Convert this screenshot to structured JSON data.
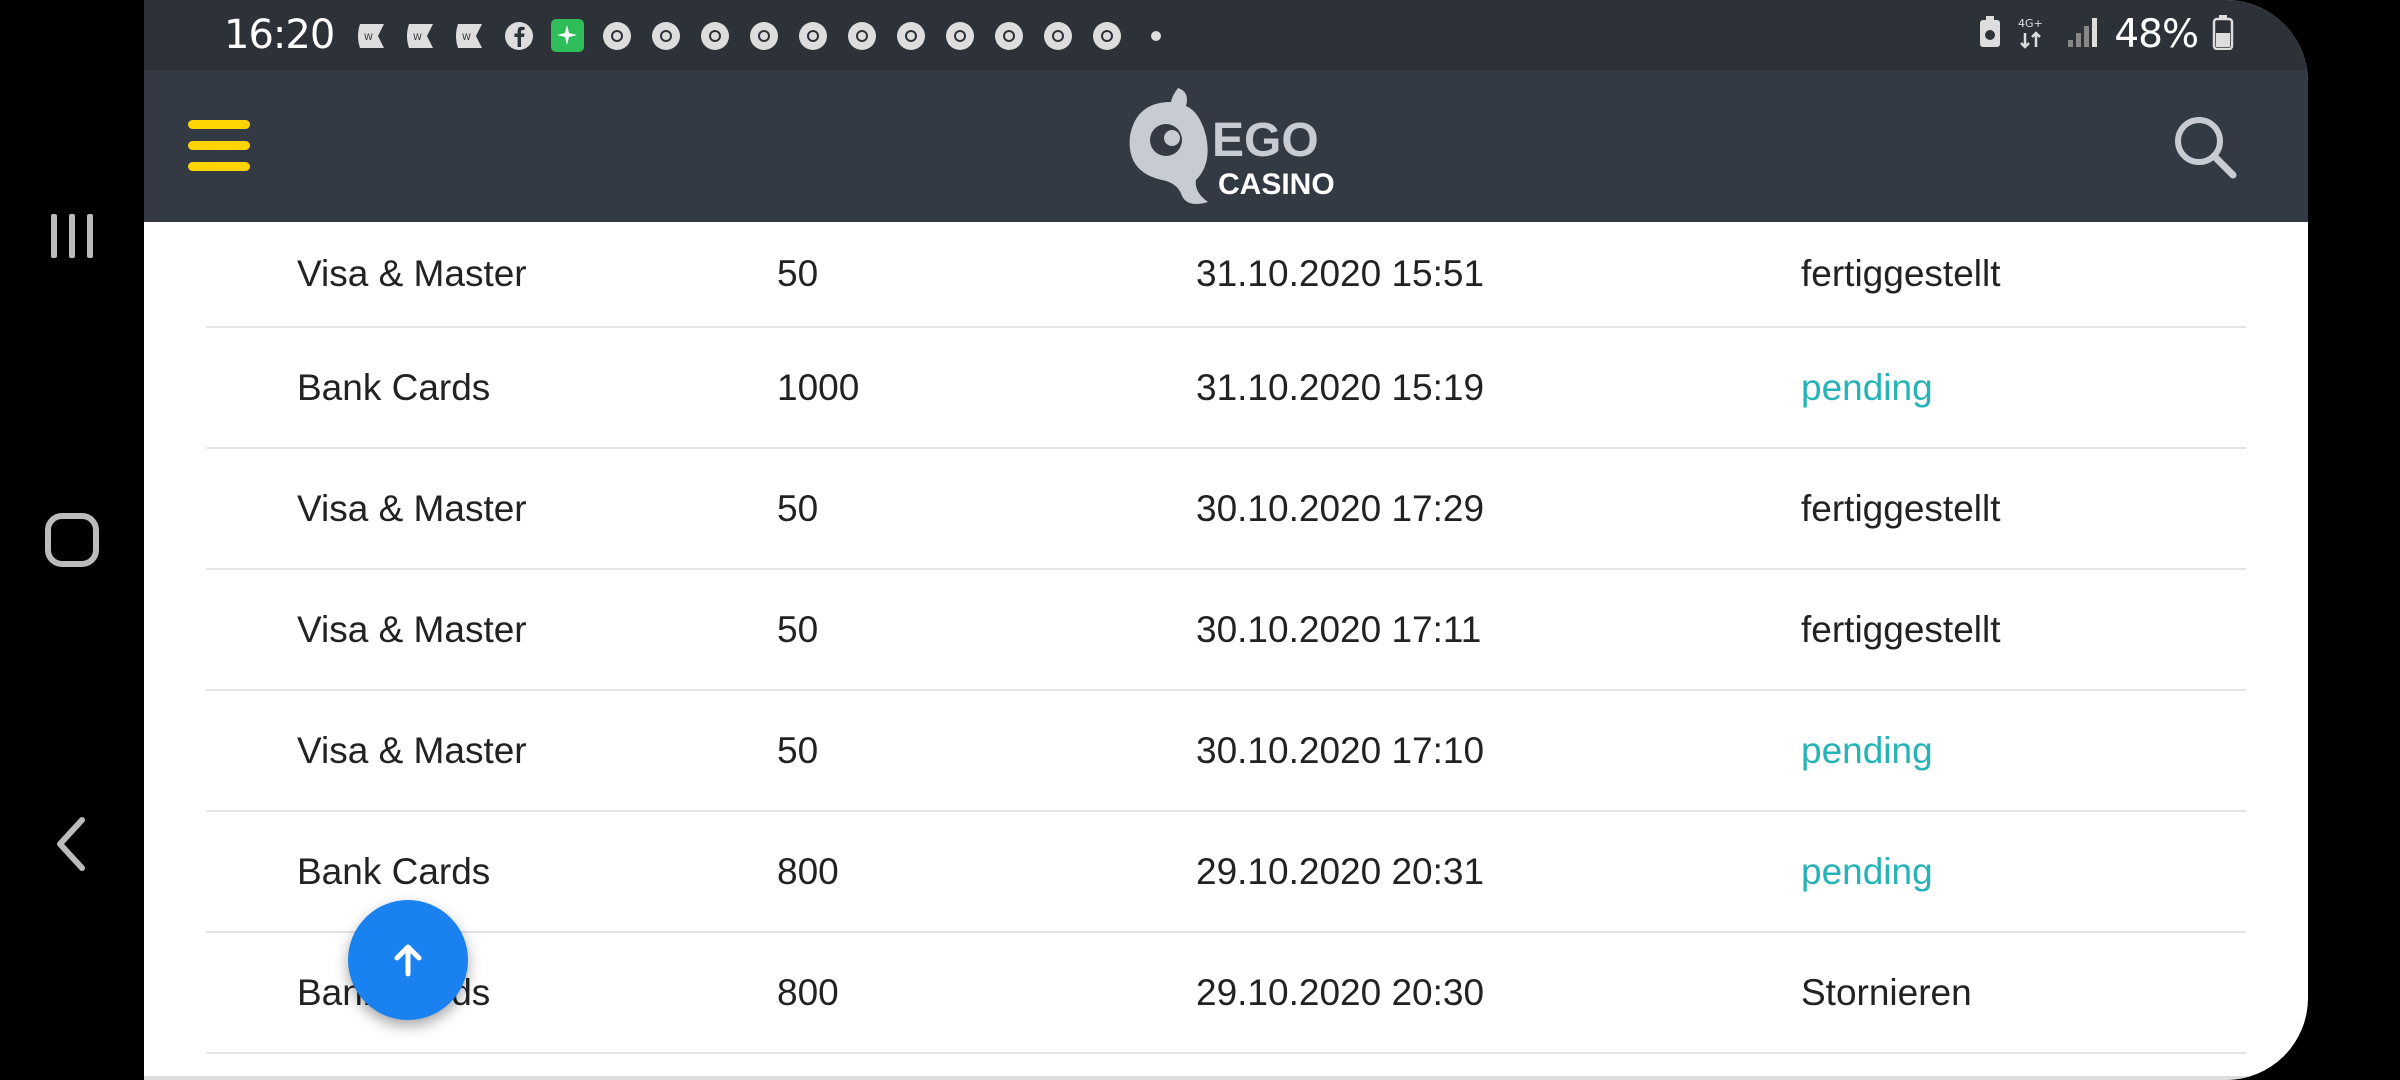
{
  "status_bar": {
    "time": "16:20",
    "notification_icons": [
      "will-icon",
      "will-icon",
      "will-icon",
      "facebook-icon",
      "green-app-icon",
      "chrome-icon",
      "chrome-icon",
      "chrome-icon",
      "chrome-icon",
      "chrome-icon",
      "chrome-icon",
      "chrome-icon",
      "chrome-icon",
      "chrome-icon",
      "chrome-icon",
      "chrome-icon",
      "dot-icon"
    ],
    "network": "4G+",
    "battery": "48%"
  },
  "header": {
    "logo_text": "EGO",
    "logo_subtext": "CASINO"
  },
  "colors": {
    "header_bg": "#343a44",
    "menu_icon": "#ffd400",
    "pending": "#26b3b8",
    "fab": "#1a82f0"
  },
  "transactions": [
    {
      "method": "Visa & Master",
      "amount": "50",
      "date": "31.10.2020 15:51",
      "status": "fertiggestellt",
      "pending": false
    },
    {
      "method": "Bank Cards",
      "amount": "1000",
      "date": "31.10.2020 15:19",
      "status": "pending",
      "pending": true
    },
    {
      "method": "Visa & Master",
      "amount": "50",
      "date": "30.10.2020 17:29",
      "status": "fertiggestellt",
      "pending": false
    },
    {
      "method": "Visa & Master",
      "amount": "50",
      "date": "30.10.2020 17:11",
      "status": "fertiggestellt",
      "pending": false
    },
    {
      "method": "Visa & Master",
      "amount": "50",
      "date": "30.10.2020 17:10",
      "status": "pending",
      "pending": true
    },
    {
      "method": "Bank Cards",
      "amount": "800",
      "date": "29.10.2020 20:31",
      "status": "pending",
      "pending": true
    },
    {
      "method": "Bank Cards",
      "amount": "800",
      "date": "29.10.2020 20:30",
      "status": "Stornieren",
      "pending": false
    }
  ]
}
